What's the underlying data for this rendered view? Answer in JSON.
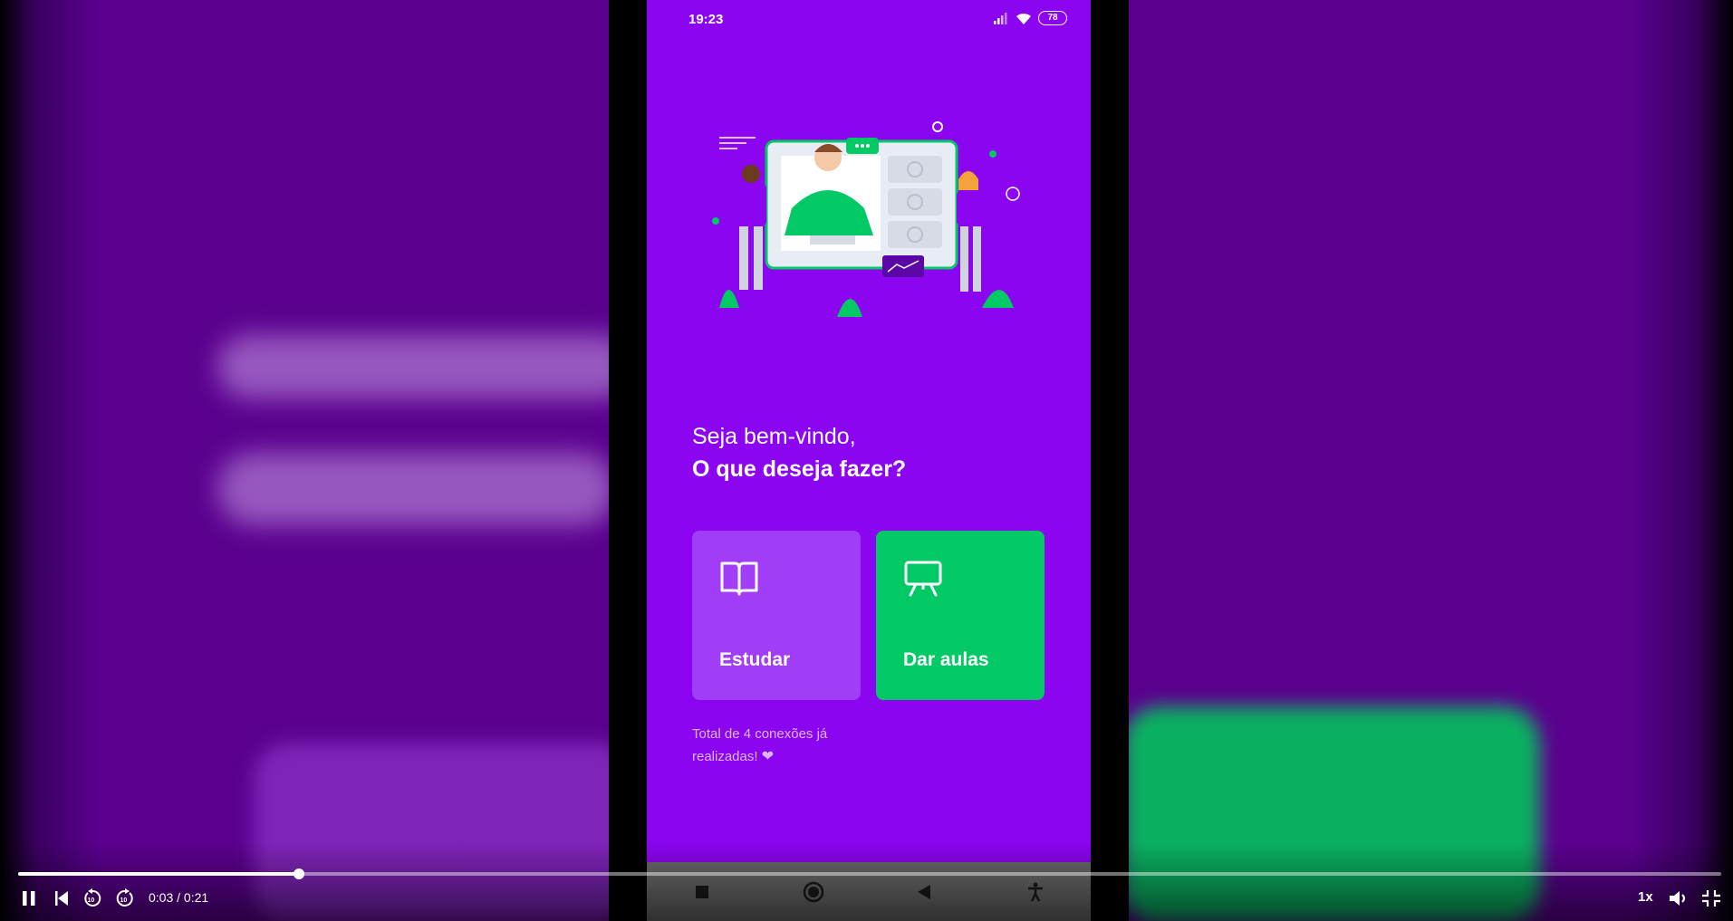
{
  "status_bar": {
    "time": "19:23",
    "battery": "78",
    "icons": [
      "signal-icon",
      "wifi-icon",
      "battery-icon"
    ]
  },
  "welcome": {
    "line1": "Seja bem-vindo,",
    "line2": "O que deseja fazer?"
  },
  "actions": {
    "study_label": "Estudar",
    "study_icon": "book-icon",
    "teach_label": "Dar aulas",
    "teach_icon": "presentation-icon"
  },
  "connections": {
    "text": "Total de 4 conexões já realizadas!",
    "icon": "heart-icon"
  },
  "android_nav": [
    "recents-icon",
    "home-icon",
    "back-icon",
    "accessibility-icon"
  ],
  "player": {
    "time_display": "0:03 / 0:21",
    "progress_fraction": 0.165,
    "playback_rate": "1x",
    "controls": [
      "pause-icon",
      "previous-icon",
      "rewind-10-icon",
      "forward-10-icon",
      "volume-icon",
      "exit-fullscreen-icon"
    ]
  },
  "colors": {
    "primary": "#8b05f0",
    "study_card": "#a23df7",
    "teach_card": "#02c865"
  }
}
